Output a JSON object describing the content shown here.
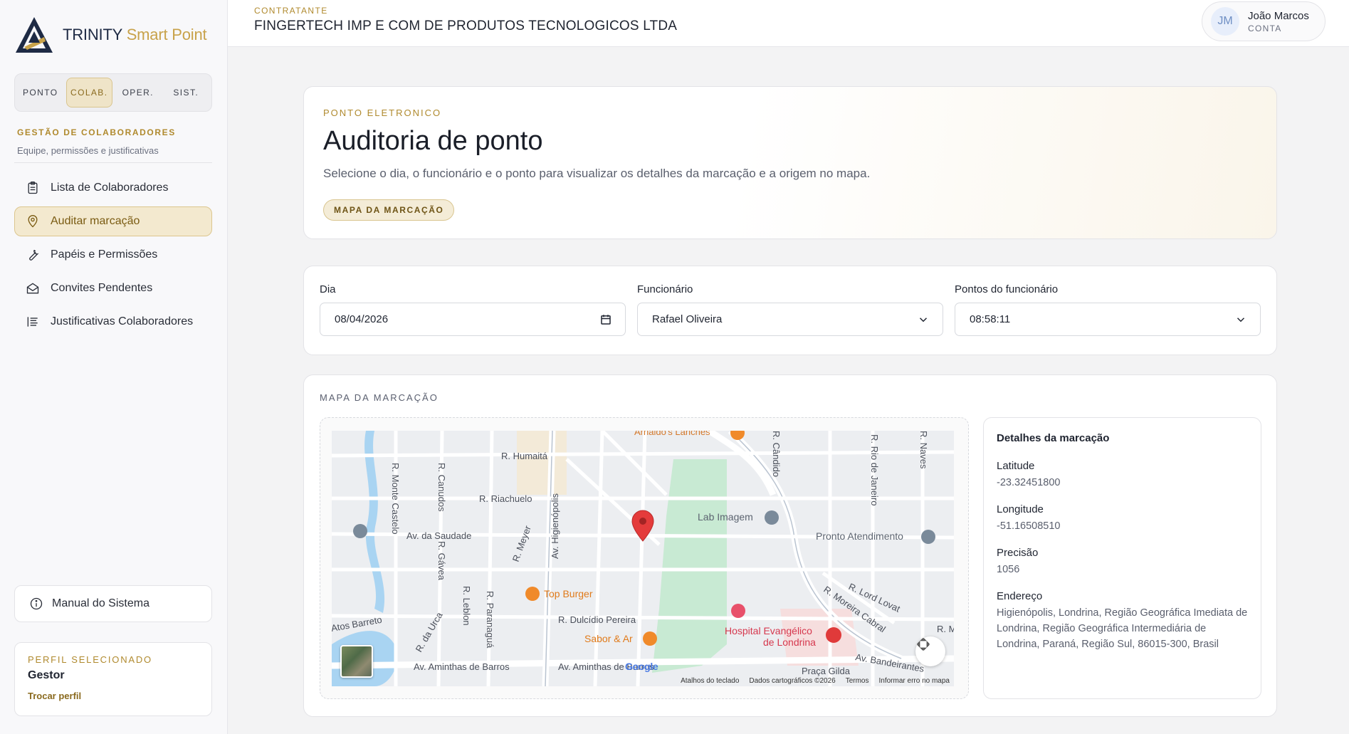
{
  "brand": {
    "name": "TRINITY",
    "accent": "Smart Point",
    "accent_color": "#c8a24a"
  },
  "mode_tabs": [
    {
      "label": "PONTO",
      "active": false
    },
    {
      "label": "COLAB.",
      "active": true
    },
    {
      "label": "OPER.",
      "active": false
    },
    {
      "label": "SIST.",
      "active": false
    }
  ],
  "sidebar": {
    "section_title": "GESTÃO DE COLABORADORES",
    "section_subtitle": "Equipe, permissões e justificativas",
    "items": [
      {
        "label": "Lista de Colaboradores",
        "icon": "clipboard-icon",
        "active": false
      },
      {
        "label": "Auditar marcação",
        "icon": "map-pin-icon",
        "active": true
      },
      {
        "label": "Papéis e Permissões",
        "icon": "wrench-icon",
        "active": false
      },
      {
        "label": "Convites Pendentes",
        "icon": "envelope-icon",
        "active": false
      },
      {
        "label": "Justificativas Colaboradores",
        "icon": "list-icon",
        "active": false
      }
    ],
    "manual_label": "Manual do Sistema",
    "profile": {
      "label": "PERFIL SELECIONADO",
      "name": "Gestor",
      "switch_label": "Trocar perfil"
    }
  },
  "header": {
    "contractor_label": "CONTRATANTE",
    "company": "FINGERTECH IMP E COM DE PRODUTOS TECNOLOGICOS LTDA",
    "user": {
      "initials": "JM",
      "name": "João Marcos",
      "role": "CONTA"
    }
  },
  "hero": {
    "eyebrow": "PONTO ELETRONICO",
    "title": "Auditoria de ponto",
    "description": "Selecione o dia, o funcionário e o ponto para visualizar os detalhes da marcação e a origem no mapa.",
    "pill": "MAPA DA MARCAÇÃO"
  },
  "filters": {
    "day": {
      "label": "Dia",
      "value": "08/04/2026"
    },
    "employee": {
      "label": "Funcionário",
      "value": "Rafael Oliveira"
    },
    "punches": {
      "label": "Pontos do funcionário",
      "value": "08:58:11"
    }
  },
  "map": {
    "eyebrow": "MAPA DA MARCAÇÃO",
    "streets": {
      "s1": "R. Humaitá",
      "s2": "R. Riachuelo",
      "s3": "Av. da Saudade",
      "s4": "R. Monte Castelo",
      "s5": "R. Canudos",
      "s6": "R. Gávea",
      "s7": "R. Meyer",
      "s8": "Av. Higienópolis",
      "s9": "R. Dulcídio Pereira",
      "s10": "R. Paranaguá",
      "s11": "R. Leblon",
      "s12": "R. da Urca",
      "s13": "Av. Aminthas de Barros",
      "s14": "Av. Aminthas de Barros",
      "s15": "R. Moreira Cabral",
      "s16": "R. Lord Lovat",
      "s17": "Av. Bandeirantes",
      "s18": "Praça Gilda",
      "s19": "R. Rio de Janeiro",
      "s20": "R. Cândido",
      "s21": "R. Naves",
      "s22": "Atos Barreto",
      "s23": "R. M",
      "s24": "Arnaldo's Lanches"
    },
    "places": {
      "p1": "Lab Imagem",
      "p2": "Pronto Atendimento",
      "p3": "Top Burger",
      "p4": "Sabor & Ar",
      "p5": "Hospital Evangélico",
      "p6": "de Londrina"
    },
    "google": "Google",
    "footer": {
      "shortcuts": "Atalhos do teclado",
      "mapdata": "Dados cartográficos ©2026",
      "terms": "Termos",
      "report": "Informar erro no mapa"
    }
  },
  "details": {
    "title": "Detalhes da marcação",
    "latitude_label": "Latitude",
    "latitude": "-23.32451800",
    "longitude_label": "Longitude",
    "longitude": "-51.16508510",
    "precision_label": "Precisão",
    "precision": "1056",
    "address_label": "Endereço",
    "address": "Higienópolis, Londrina, Região Geográfica Imediata de Londrina, Região Geográfica Intermediária de Londrina, Paraná, Região Sul, 86015-300, Brasil"
  }
}
